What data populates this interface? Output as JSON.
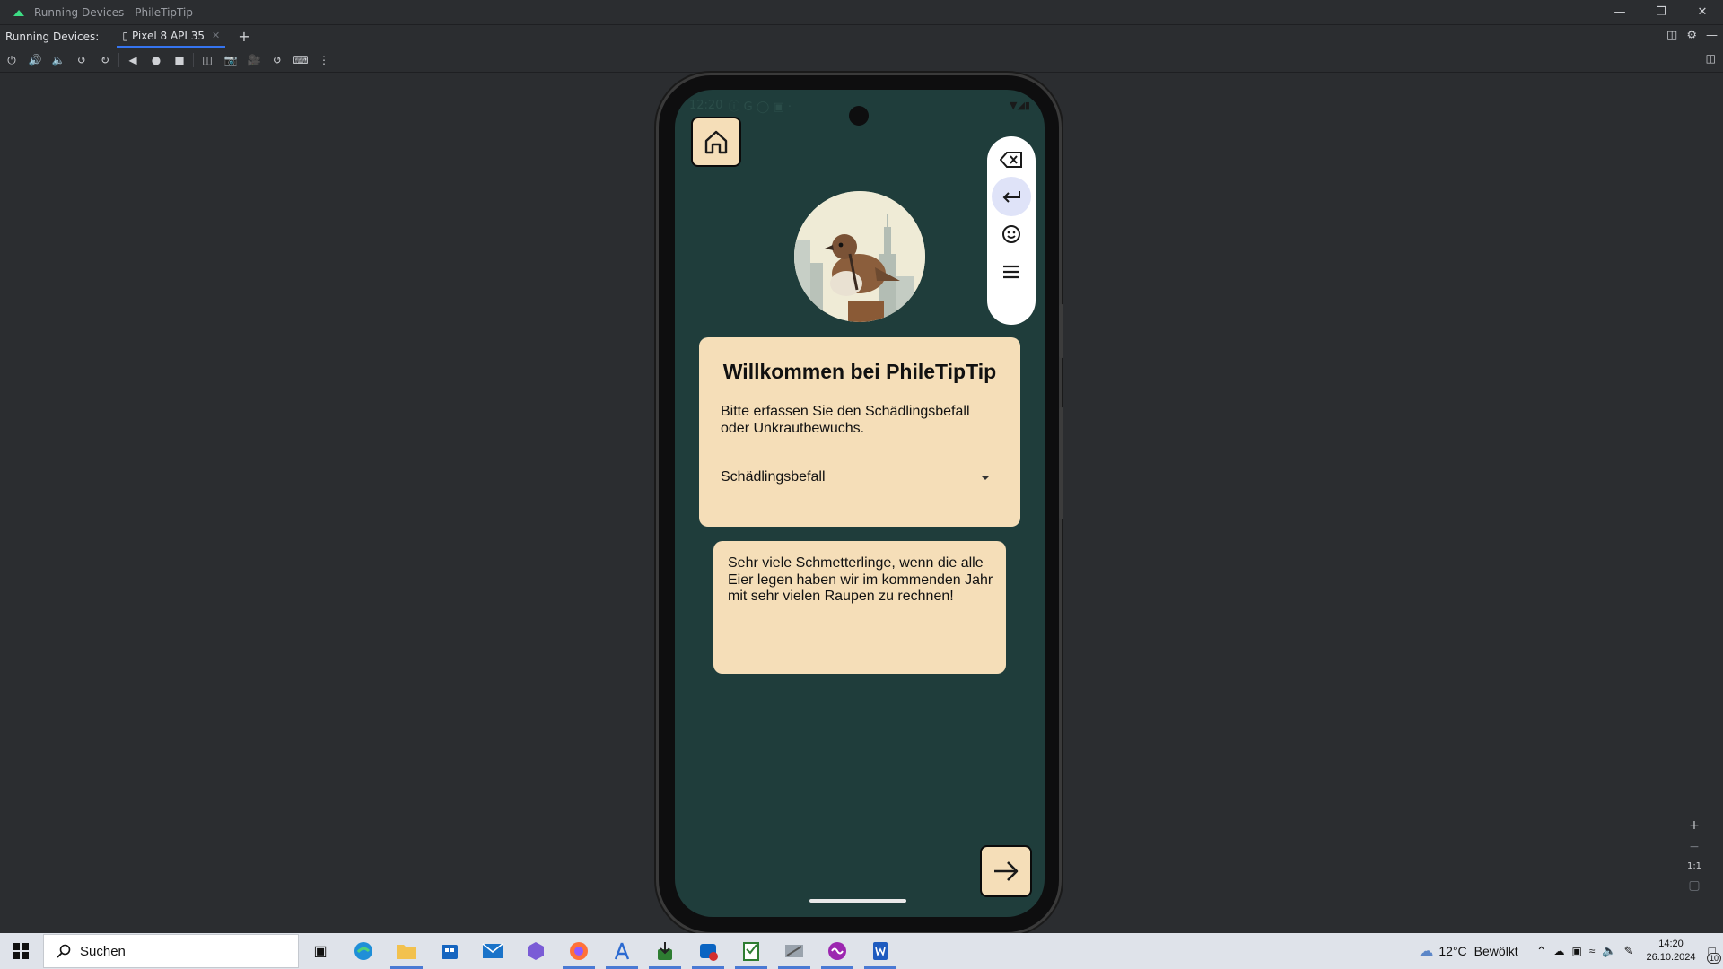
{
  "ide": {
    "window_title": "Running Devices - PhileTipTip",
    "running_devices_label": "Running Devices:",
    "device_tab": "Pixel 8 API 35"
  },
  "zoom": {
    "ratio": "1:1"
  },
  "app": {
    "status_time": "12:20",
    "welcome_title": "Willkommen bei PhileTipTip",
    "subtitle": "Bitte erfassen Sie den Schädlingsbefall oder Unkrautbewuchs.",
    "dropdown_value": "Schädlingsbefall",
    "note_text": "Sehr viele Schmetterlinge, wenn die alle\nEier legen haben wir im kommenden Jahr\nmit sehr vielen Raupen zu rechnen!",
    "keyboard_toolbar_icons": [
      "backspace-icon",
      "enter-icon",
      "emoji-icon",
      "menu-icon"
    ]
  },
  "taskbar": {
    "search_placeholder": "Suchen",
    "weather_temp": "12°C",
    "weather_desc": "Bewölkt",
    "time": "14:20",
    "date": "26.10.2024",
    "notification_count": "10"
  }
}
